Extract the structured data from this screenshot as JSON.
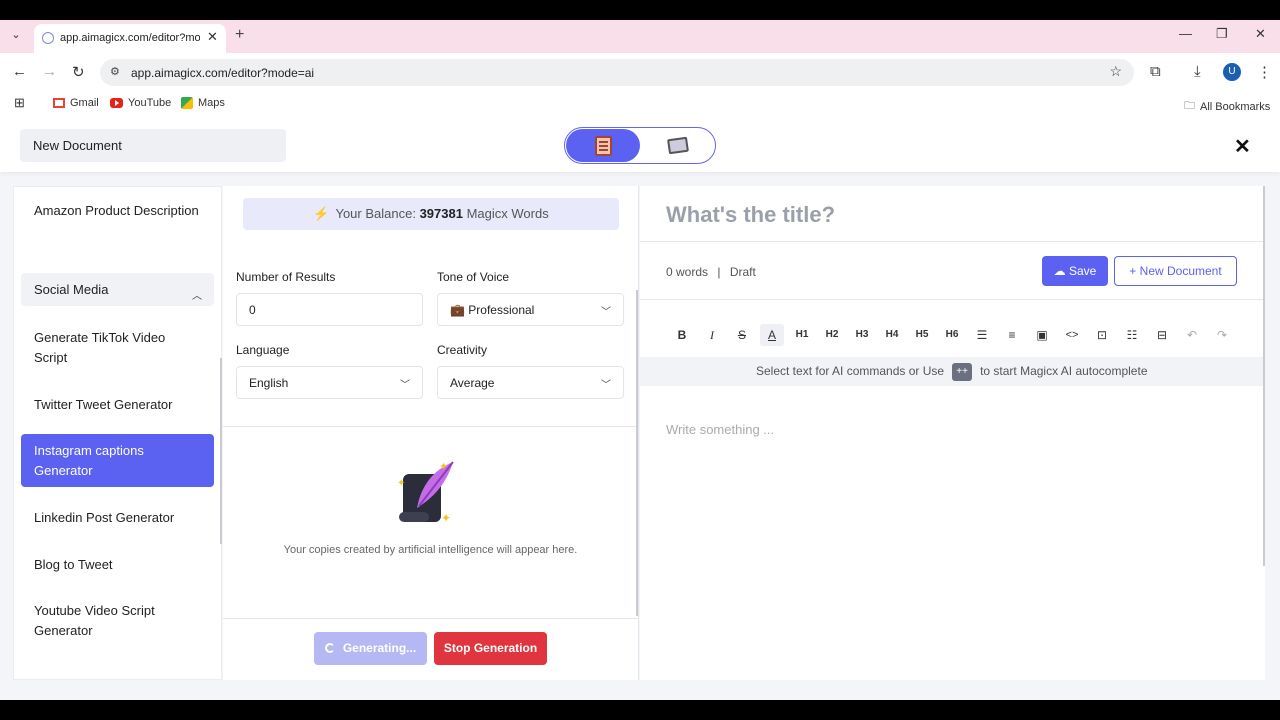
{
  "browser": {
    "tab_title": "app.aimagicx.com/editor?mode=ai",
    "url": "app.aimagicx.com/editor?mode=ai",
    "avatar_letter": "U",
    "bookmarks": [
      "Gmail",
      "YouTube",
      "Maps"
    ],
    "all_bookmarks": "All Bookmarks"
  },
  "header": {
    "document_name": "New Document"
  },
  "sidebar": {
    "items": [
      {
        "label": "Amazon Product Description"
      },
      {
        "label": "Social Media"
      },
      {
        "label": "Generate TikTok Video Script"
      },
      {
        "label": "Twitter Tweet Generator"
      },
      {
        "label": "Instagram captions Generator"
      },
      {
        "label": "Linkedin Post Generator"
      },
      {
        "label": "Blog to Tweet"
      },
      {
        "label": "Youtube Video Script Generator"
      }
    ],
    "active_index": 4
  },
  "form": {
    "balance_prefix": "Your Balance:",
    "balance_value": "397381",
    "balance_suffix": "Magicx Words",
    "num_results_label": "Number of Results",
    "num_results_value": "0",
    "tone_label": "Tone of Voice",
    "tone_value": "Professional",
    "language_label": "Language",
    "language_value": "English",
    "creativity_label": "Creativity",
    "creativity_value": "Average",
    "empty_message": "Your copies created by artificial intelligence will appear here.",
    "generating_label": "Generating...",
    "stop_label": "Stop Generation"
  },
  "editor": {
    "title_placeholder": "What's the title?",
    "word_count": "0 words",
    "status": "Draft",
    "save_label": "Save",
    "new_document_label": "New Document",
    "hint_before": "Select text for AI commands or Use",
    "hint_key": "++",
    "hint_after": "to start Magicx AI autocomplete",
    "body_placeholder": "Write something ...",
    "toolbar": [
      "B",
      "I",
      "S",
      "A",
      "H1",
      "H2",
      "H3",
      "H4",
      "H5",
      "H6"
    ]
  },
  "colors": {
    "accent": "#5b61f0",
    "danger": "#e0353e"
  }
}
